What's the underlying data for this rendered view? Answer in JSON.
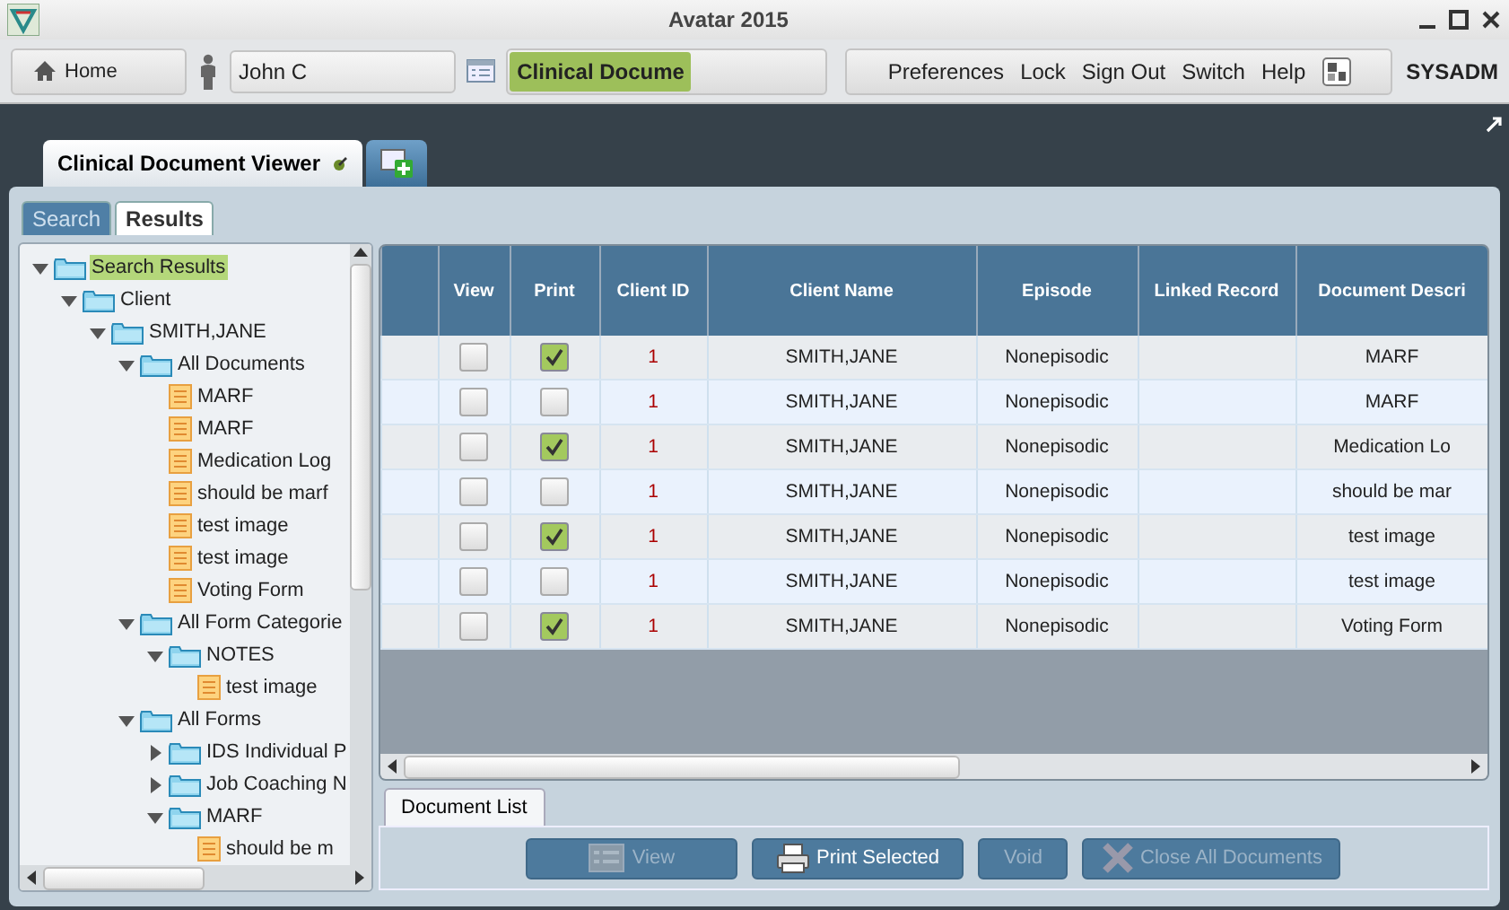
{
  "window": {
    "title": "Avatar 2015"
  },
  "toolbar": {
    "home_button": "Home",
    "client_field": "John C",
    "form_field": "Clinical Docume",
    "links": [
      "Preferences",
      "Lock",
      "Sign Out",
      "Switch",
      "Help"
    ],
    "user": "SYSADM"
  },
  "tabs": [
    {
      "label": "Clinical Document Viewer",
      "selected": true
    }
  ],
  "side_tabs": [
    {
      "label": "Search",
      "selected": false
    },
    {
      "label": "Results",
      "selected": true
    }
  ],
  "tree": [
    {
      "label": "Search Results",
      "kind": "folder",
      "expanded": true,
      "selected": true,
      "children": [
        {
          "label": "Client",
          "kind": "folder",
          "expanded": true,
          "selected": false,
          "children": [
            {
              "label": "SMITH,JANE",
              "kind": "folder",
              "expanded": true,
              "selected": false,
              "children": [
                {
                  "label": "All Documents",
                  "kind": "folder",
                  "expanded": true,
                  "selected": false,
                  "children": [
                    {
                      "label": "MARF",
                      "kind": "document",
                      "selected": false
                    },
                    {
                      "label": "MARF",
                      "kind": "document",
                      "selected": false
                    },
                    {
                      "label": "Medication Log",
                      "kind": "document",
                      "selected": false
                    },
                    {
                      "label": "should be marf",
                      "kind": "document",
                      "selected": false
                    },
                    {
                      "label": "test image",
                      "kind": "document",
                      "selected": false
                    },
                    {
                      "label": "test image",
                      "kind": "document",
                      "selected": false
                    },
                    {
                      "label": "Voting Form",
                      "kind": "document",
                      "selected": false
                    }
                  ]
                },
                {
                  "label": "All Form Categorie",
                  "kind": "folder",
                  "expanded": true,
                  "selected": false,
                  "children": [
                    {
                      "label": "NOTES",
                      "kind": "folder",
                      "expanded": true,
                      "selected": false,
                      "children": [
                        {
                          "label": "test image",
                          "kind": "document",
                          "selected": false
                        }
                      ]
                    }
                  ]
                },
                {
                  "label": "All Forms",
                  "kind": "folder",
                  "expanded": true,
                  "selected": false,
                  "children": [
                    {
                      "label": "IDS Individual P",
                      "kind": "folder",
                      "expanded": false,
                      "selected": false
                    },
                    {
                      "label": "Job Coaching N",
                      "kind": "folder",
                      "expanded": false,
                      "selected": false
                    },
                    {
                      "label": "MARF",
                      "kind": "folder",
                      "expanded": true,
                      "selected": false,
                      "children": [
                        {
                          "label": "should be m",
                          "kind": "document",
                          "selected": false
                        }
                      ]
                    }
                  ]
                }
              ]
            }
          ]
        }
      ]
    }
  ],
  "table": {
    "columns": [
      "View",
      "Print",
      "Client ID",
      "Client Name",
      "Episode",
      "Linked Record",
      "Document Descri"
    ],
    "rows": [
      {
        "view": false,
        "print": true,
        "client_id": "1",
        "client_name": "SMITH,JANE",
        "episode": "Nonepisodic",
        "document_description": "MARF"
      },
      {
        "view": false,
        "print": false,
        "client_id": "1",
        "client_name": "SMITH,JANE",
        "episode": "Nonepisodic",
        "document_description": "MARF"
      },
      {
        "view": false,
        "print": true,
        "client_id": "1",
        "client_name": "SMITH,JANE",
        "episode": "Nonepisodic",
        "document_description": "Medication Lo"
      },
      {
        "view": false,
        "print": false,
        "client_id": "1",
        "client_name": "SMITH,JANE",
        "episode": "Nonepisodic",
        "document_description": "should be mar"
      },
      {
        "view": false,
        "print": true,
        "client_id": "1",
        "client_name": "SMITH,JANE",
        "episode": "Nonepisodic",
        "document_description": "test image"
      },
      {
        "view": false,
        "print": false,
        "client_id": "1",
        "client_name": "SMITH,JANE",
        "episode": "Nonepisodic",
        "document_description": "test image"
      },
      {
        "view": false,
        "print": true,
        "client_id": "1",
        "client_name": "SMITH,JANE",
        "episode": "Nonepisodic",
        "document_description": "Voting Form"
      }
    ]
  },
  "bottom_tabs": [
    {
      "label": "Document List",
      "selected": true
    }
  ],
  "buttons": [
    {
      "label": "View",
      "kind": "list",
      "disabled": true
    },
    {
      "label": "Print Selected",
      "kind": "print",
      "disabled": false
    },
    {
      "label": "Void",
      "kind": "plain",
      "disabled": true
    },
    {
      "label": "Close All Documents",
      "kind": "close",
      "disabled": true
    }
  ]
}
